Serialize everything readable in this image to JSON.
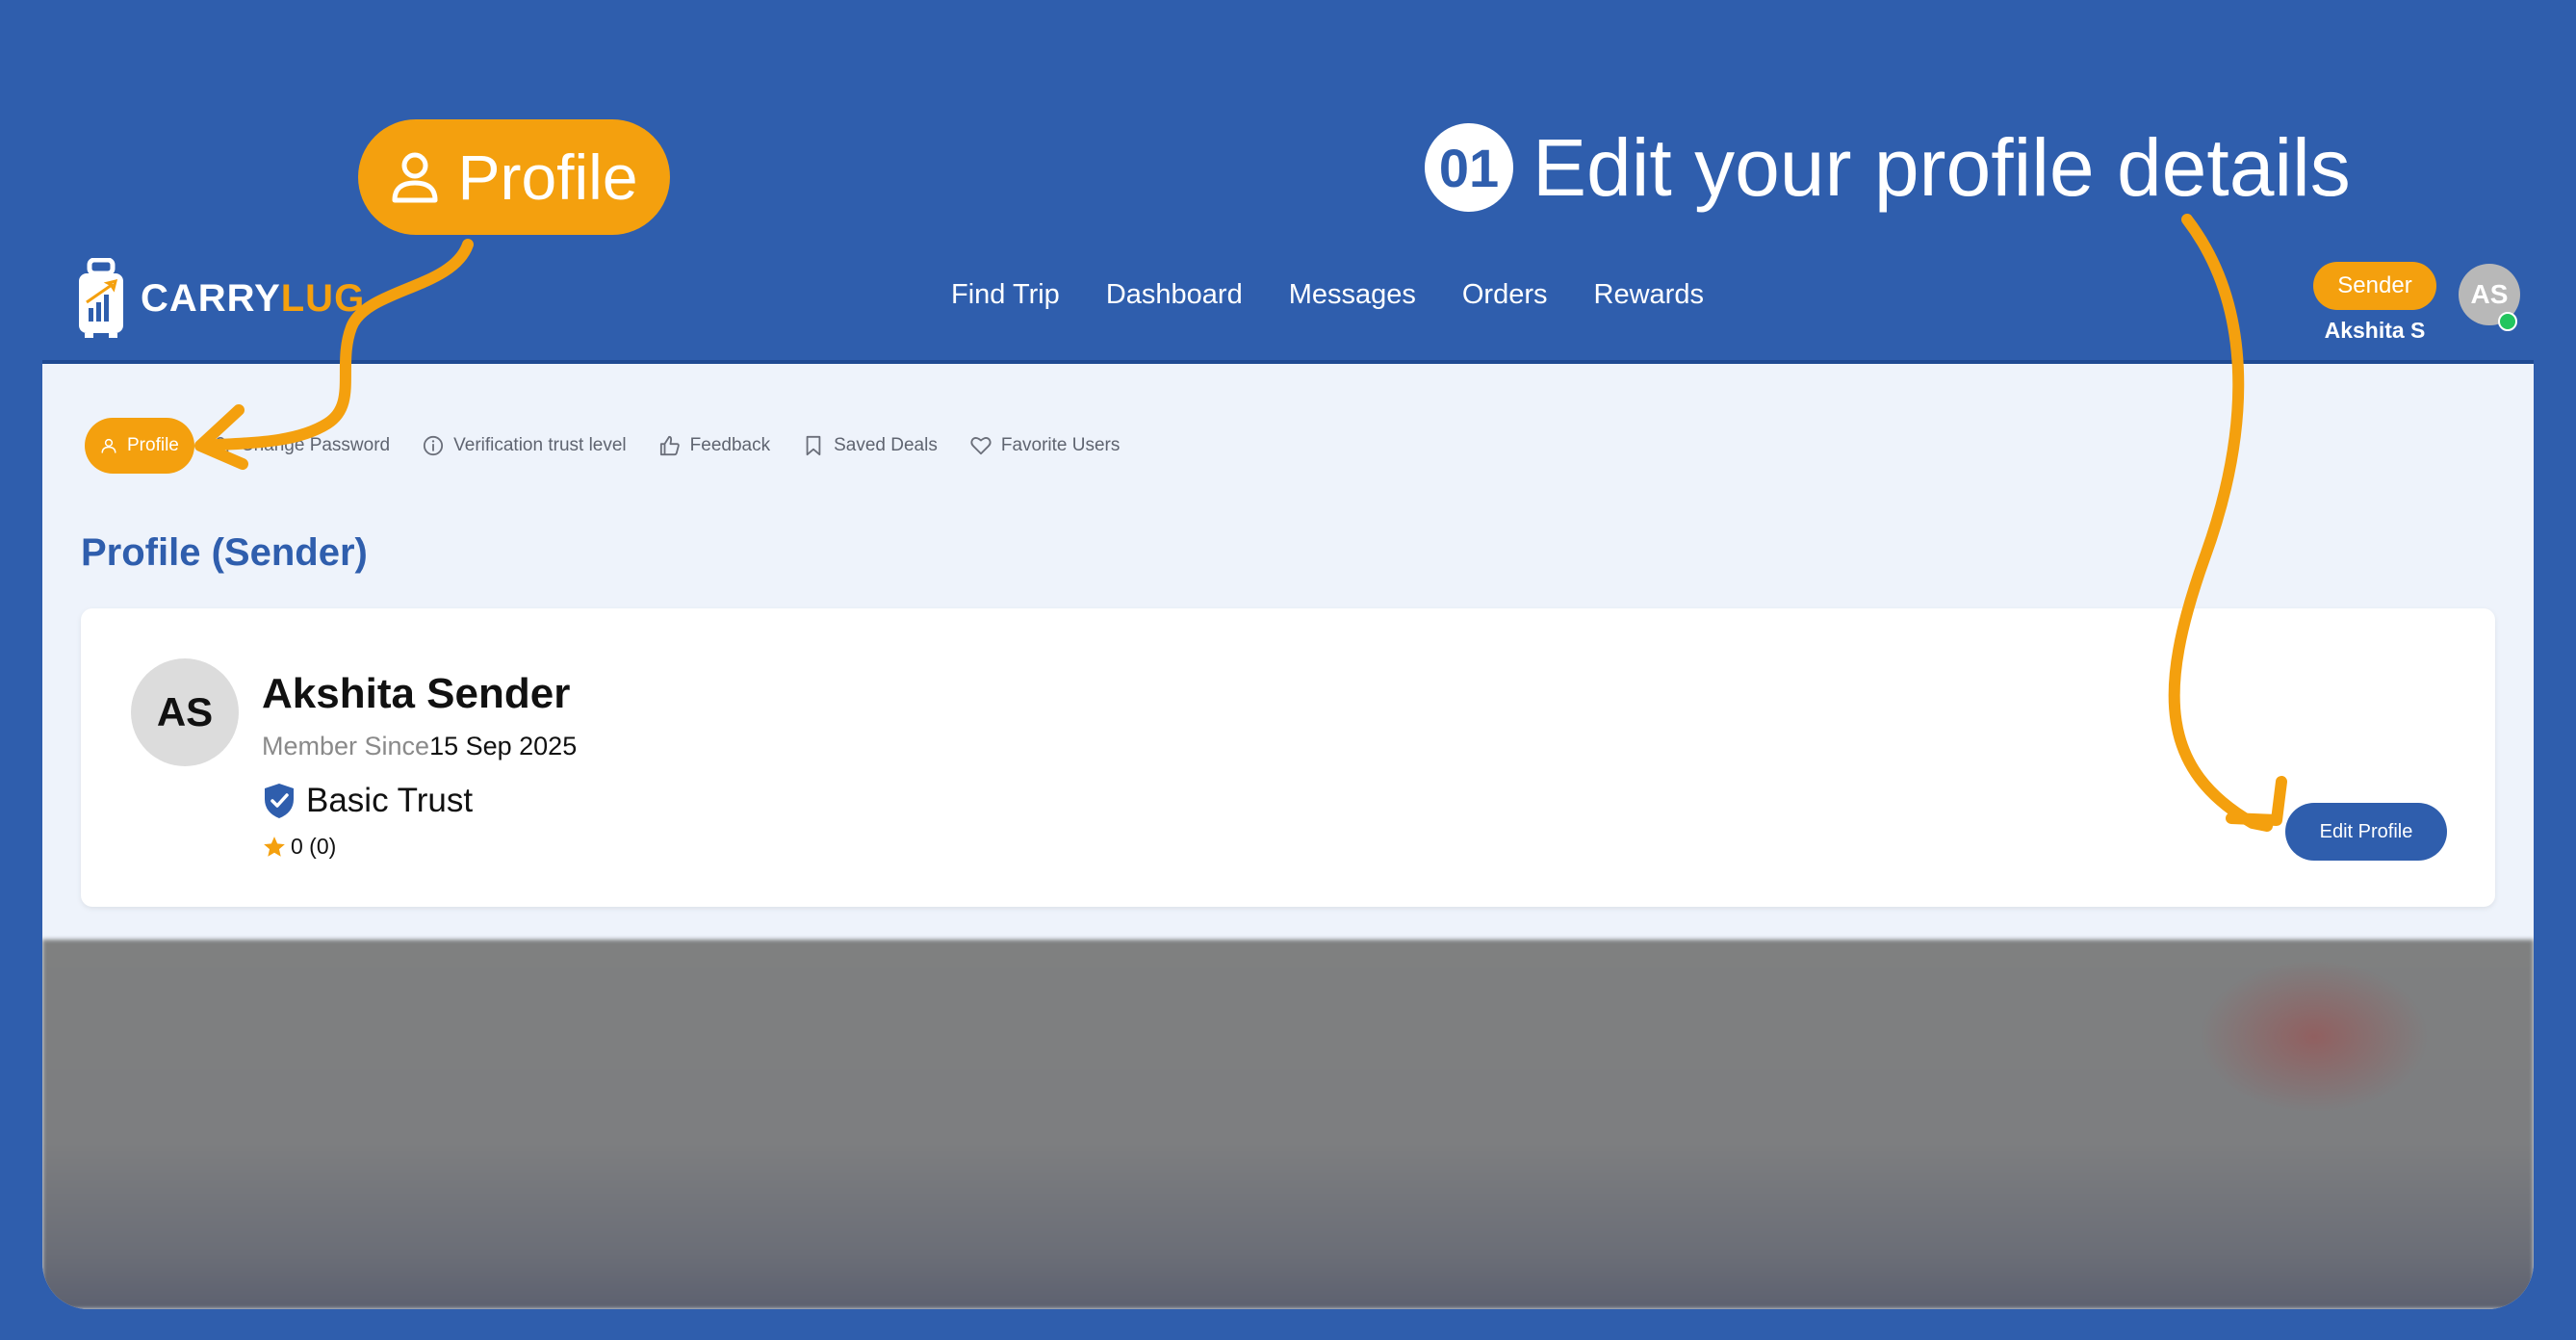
{
  "callout": {
    "label": "Profile",
    "icon": "user-icon"
  },
  "step": {
    "number": "01",
    "text": "Edit your profile details"
  },
  "brand": {
    "name_part1": "C",
    "name_a": "A",
    "name_part2": "RRY",
    "name_part3": "LUG",
    "accent_color": "#f4a00e",
    "primary_color": "#2f5ead"
  },
  "nav": {
    "links": [
      "Find Trip",
      "Dashboard",
      "Messages",
      "Orders",
      "Rewards"
    ],
    "role": "Sender",
    "user_name": "Akshita S",
    "avatar_initials": "AS"
  },
  "tabs": [
    {
      "label": "Profile",
      "icon": "user-icon",
      "active": true
    },
    {
      "label": "Change Password",
      "icon": "lock-icon"
    },
    {
      "label": "Verification trust level",
      "icon": "info-icon"
    },
    {
      "label": "Feedback",
      "icon": "thumbs-up-icon"
    },
    {
      "label": "Saved Deals",
      "icon": "bookmark-icon"
    },
    {
      "label": "Favorite Users",
      "icon": "heart-icon"
    }
  ],
  "page_title": "Profile (Sender)",
  "profile": {
    "initials": "AS",
    "name": "Akshita Sender",
    "member_label": "Member Since",
    "member_date": "15 Sep 2025",
    "trust_level": "Basic Trust",
    "rating": "0 (0)",
    "edit_button": "Edit Profile"
  }
}
